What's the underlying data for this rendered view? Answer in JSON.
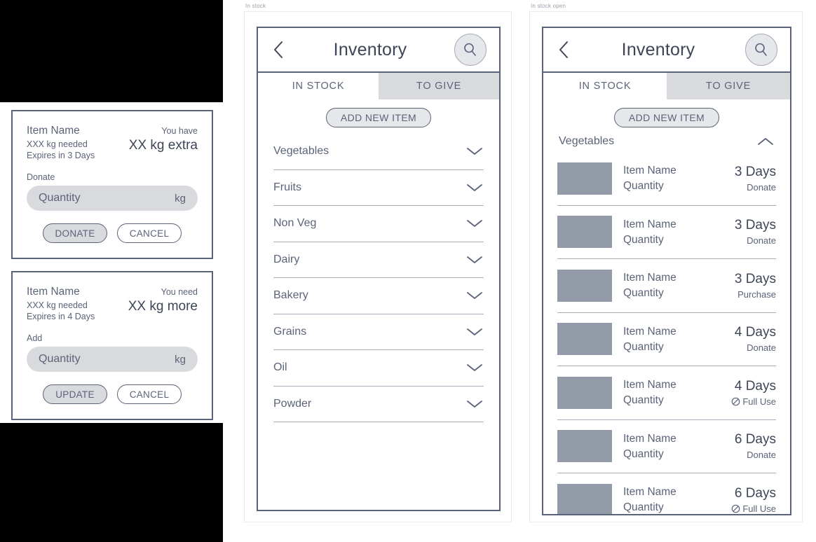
{
  "mocks": {
    "middle_caption": "In stock",
    "right_caption": "In stock open"
  },
  "colors": {
    "ink": "#5b6379",
    "ink_dark": "#3e4557",
    "rule": "#a9adb8",
    "fill": "#d9dadd",
    "thumb": "#939aa8",
    "band": "#000000"
  },
  "dialogs": [
    {
      "id": "donate",
      "item_name": "Item Name",
      "needed": "XXX kg needed",
      "expires": "Expires in 3 Days",
      "status_label": "You have",
      "status_amount": "XX kg extra",
      "field_label": "Donate",
      "field_placeholder": "Quantity",
      "field_unit": "kg",
      "primary_button": "DONATE",
      "secondary_button": "CANCEL"
    },
    {
      "id": "update",
      "item_name": "Item Name",
      "needed": "XXX kg needed",
      "expires": "Expires in 4 Days",
      "status_label": "You need",
      "status_amount": "XX kg more",
      "field_label": "Add",
      "field_placeholder": "Quantity",
      "field_unit": "kg",
      "primary_button": "UPDATE",
      "secondary_button": "CANCEL"
    }
  ],
  "phone_middle": {
    "header": {
      "title": "Inventory",
      "back_icon": "chevron-left-icon",
      "search_icon": "search-icon"
    },
    "tabs": [
      {
        "label": "IN STOCK",
        "active": true
      },
      {
        "label": "TO GIVE",
        "active": false
      }
    ],
    "add_button": "ADD NEW ITEM",
    "categories": [
      {
        "label": "Vegetables",
        "expand_icon": "chevron-down-icon"
      },
      {
        "label": "Fruits",
        "expand_icon": "chevron-down-icon"
      },
      {
        "label": "Non Veg",
        "expand_icon": "chevron-down-icon"
      },
      {
        "label": "Dairy",
        "expand_icon": "chevron-down-icon"
      },
      {
        "label": "Bakery",
        "expand_icon": "chevron-down-icon"
      },
      {
        "label": "Grains",
        "expand_icon": "chevron-down-icon"
      },
      {
        "label": "Oil",
        "expand_icon": "chevron-down-icon"
      },
      {
        "label": "Powder",
        "expand_icon": "chevron-down-icon"
      }
    ]
  },
  "phone_right": {
    "header": {
      "title": "Inventory",
      "back_icon": "chevron-left-icon",
      "search_icon": "search-icon"
    },
    "tabs": [
      {
        "label": "IN STOCK",
        "active": true
      },
      {
        "label": "TO GIVE",
        "active": false
      }
    ],
    "add_button": "ADD NEW ITEM",
    "section": {
      "title": "Vegetables",
      "collapse_icon": "chevron-up-icon"
    },
    "items": [
      {
        "name": "Item Name",
        "quantity": "Quantity",
        "days": "3 Days",
        "action": "Donate",
        "action_icon": null
      },
      {
        "name": "Item Name",
        "quantity": "Quantity",
        "days": "3 Days",
        "action": "Donate",
        "action_icon": null
      },
      {
        "name": "Item Name",
        "quantity": "Quantity",
        "days": "3 Days",
        "action": "Purchase",
        "action_icon": null
      },
      {
        "name": "Item Name",
        "quantity": "Quantity",
        "days": "4 Days",
        "action": "Donate",
        "action_icon": null
      },
      {
        "name": "Item Name",
        "quantity": "Quantity",
        "days": "4 Days",
        "action": "Full Use",
        "action_icon": "ban-circle-icon"
      },
      {
        "name": "Item Name",
        "quantity": "Quantity",
        "days": "6 Days",
        "action": "Donate",
        "action_icon": null
      },
      {
        "name": "Item Name",
        "quantity": "Quantity",
        "days": "6 Days",
        "action": "Full Use",
        "action_icon": "ban-circle-icon"
      }
    ]
  }
}
